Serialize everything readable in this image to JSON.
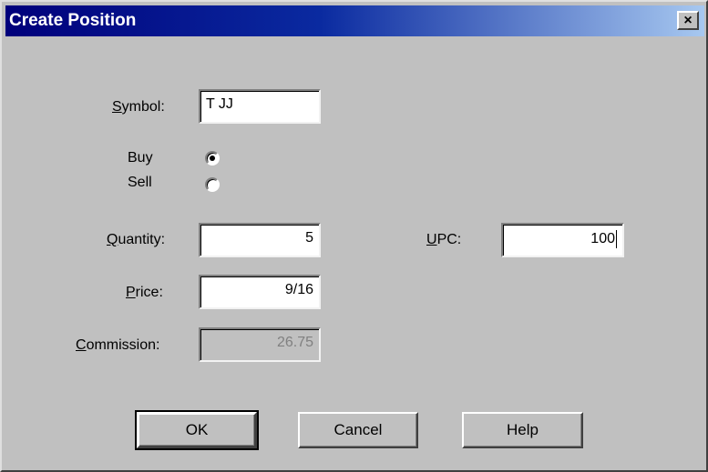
{
  "window": {
    "title": "Create Position",
    "close_glyph": "×"
  },
  "form": {
    "symbol_label_first": "S",
    "symbol_label_rest": "ymbol:",
    "symbol_value": "T JJ",
    "buy_label": "Buy",
    "sell_label": "Sell",
    "side_selected": "Buy",
    "quantity_label_first": "Q",
    "quantity_label_rest": "uantity:",
    "quantity_value": "5",
    "upc_label_first": "U",
    "upc_label_rest": "PC:",
    "upc_value": "100",
    "price_label_first": "P",
    "price_label_rest": "rice:",
    "price_value": "9/16",
    "commission_label_first": "C",
    "commission_label_rest": "ommission:",
    "commission_value": "26.75"
  },
  "buttons": {
    "ok": "OK",
    "cancel": "Cancel",
    "help": "Help"
  },
  "icons": {
    "close": "close-icon",
    "radio": "radio-icon"
  }
}
